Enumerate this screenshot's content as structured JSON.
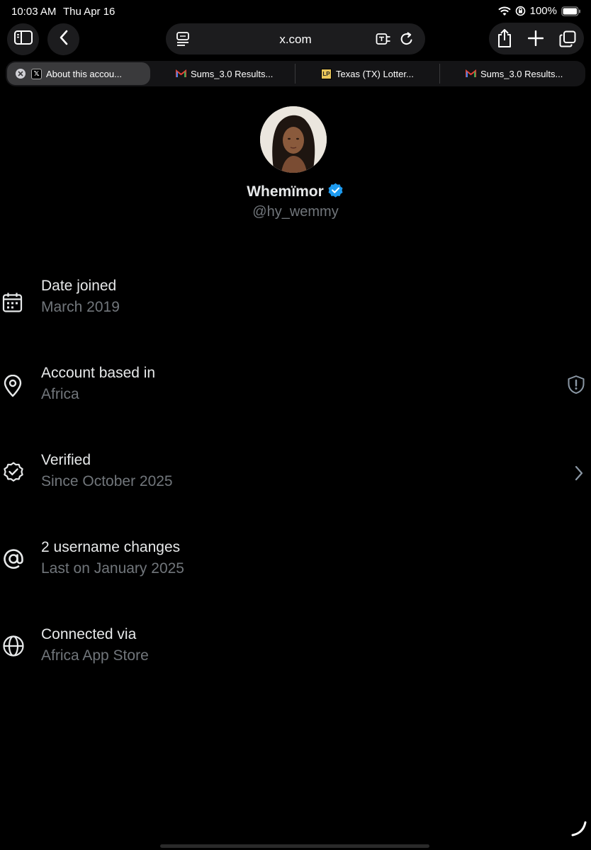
{
  "status_bar": {
    "time": "10:03 AM",
    "date": "Thu Apr 16",
    "battery": "100%",
    "icons": [
      "wifi-icon",
      "orientation-lock-icon",
      "battery-icon"
    ]
  },
  "toolbar": {
    "url": "x.com",
    "icons": [
      "sidebar-icon",
      "back-icon",
      "reader-icon",
      "translate-icon",
      "reload-icon",
      "share-icon",
      "new-tab-icon",
      "tabs-overview-icon"
    ]
  },
  "tabs": [
    {
      "title": "About this accou...",
      "favicon": "x-logo-icon",
      "active": true
    },
    {
      "title": "Sums_3.0 Results...",
      "favicon": "gmail-icon",
      "active": false
    },
    {
      "title": "Texas (TX) Lotter...",
      "favicon": "lottery-icon",
      "active": false
    },
    {
      "title": "Sums_3.0 Results...",
      "favicon": "gmail-icon",
      "active": false
    }
  ],
  "profile": {
    "display_name": "Whemïmor",
    "handle": "@hy_wemmy",
    "verified": true,
    "verified_color": "#1d9bf0"
  },
  "about": [
    {
      "icon": "calendar-icon",
      "title": "Date joined",
      "subtitle": "March 2019",
      "trailing": null
    },
    {
      "icon": "location-pin-icon",
      "title": "Account based in",
      "subtitle": "Africa",
      "trailing": "shield-alert-icon"
    },
    {
      "icon": "verified-badge-icon",
      "title": "Verified",
      "subtitle": "Since October 2025",
      "trailing": "chevron-right-icon"
    },
    {
      "icon": "at-sign-icon",
      "title": "2 username changes",
      "subtitle": "Last on January 2025",
      "trailing": null
    },
    {
      "icon": "globe-icon",
      "title": "Connected via",
      "subtitle": "Africa App Store",
      "trailing": null
    }
  ],
  "colors": {
    "background": "#000000",
    "primary_text": "#e7e9ea",
    "secondary_text": "#71767b",
    "accent": "#1d9bf0"
  }
}
